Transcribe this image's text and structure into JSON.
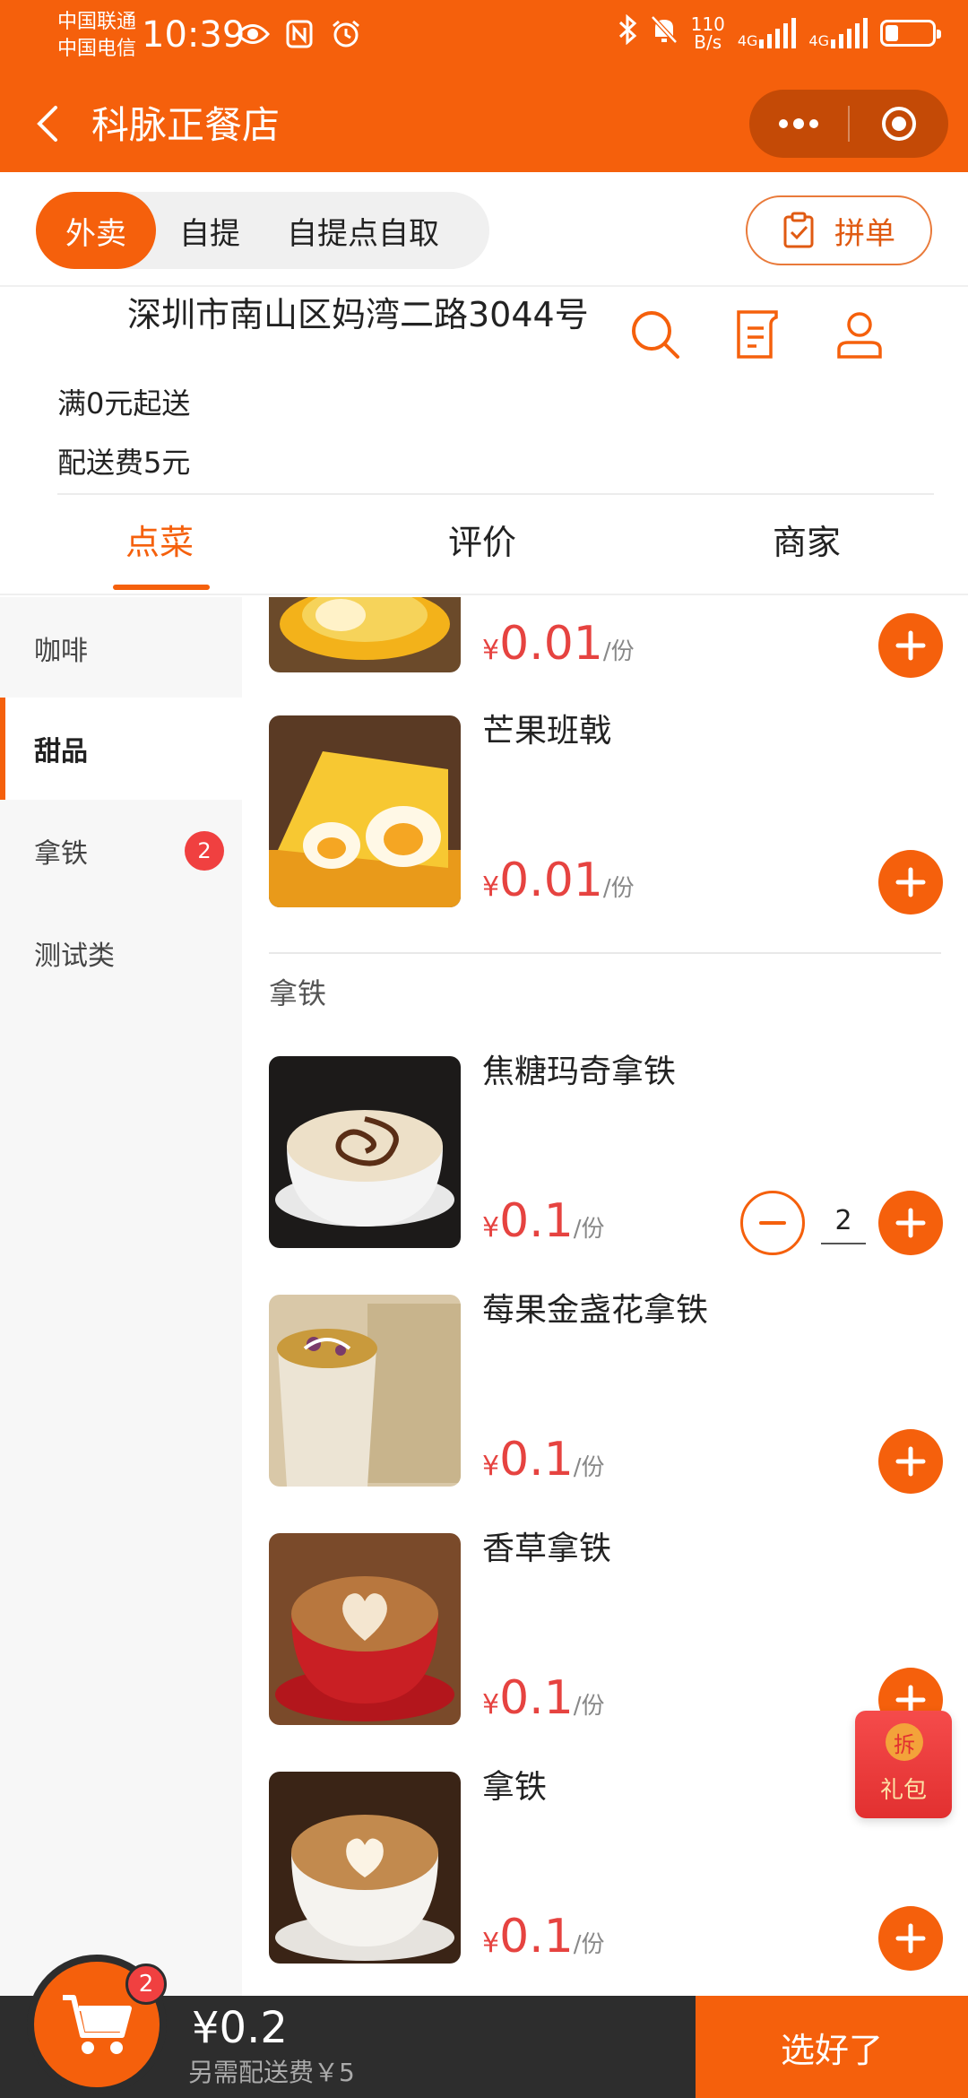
{
  "status_bar": {
    "carrier1": "中国联通",
    "carrier2": "中国电信",
    "time": "10:39",
    "speed_value": "110",
    "speed_unit": "B/s",
    "net1": "4G",
    "net2": "4G"
  },
  "titlebar": {
    "title": "科脉正餐店"
  },
  "modes": {
    "items": [
      "外卖",
      "自提",
      "自提点自取"
    ],
    "pin_label": "拼单"
  },
  "store": {
    "address": "深圳市南山区妈湾二路3044号",
    "min_order": "满0元起送",
    "delivery_fee": "配送费5元"
  },
  "tabs": [
    "点菜",
    "评价",
    "商家"
  ],
  "sidebar": {
    "items": [
      {
        "label": "咖啡"
      },
      {
        "label": "甜品"
      },
      {
        "label": "拿铁",
        "badge": "2"
      },
      {
        "label": "测试类"
      }
    ]
  },
  "products": {
    "partial": {
      "yen": "¥",
      "price": "0.01",
      "unit": "/份"
    },
    "mango": {
      "name": "芒果班戟",
      "yen": "¥",
      "price": "0.01",
      "unit": "/份"
    },
    "section_title": "拿铁",
    "caramel": {
      "name": "焦糖玛奇拿铁",
      "yen": "¥",
      "price": "0.1",
      "unit": "/份",
      "qty": "2"
    },
    "berry": {
      "name": "莓果金盏花拿铁",
      "yen": "¥",
      "price": "0.1",
      "unit": "/份"
    },
    "vanilla": {
      "name": "香草拿铁",
      "yen": "¥",
      "price": "0.1",
      "unit": "/份"
    },
    "latte": {
      "name": "拿铁",
      "yen": "¥",
      "price": "0.1",
      "unit": "/份"
    }
  },
  "gift": {
    "coin": "拆",
    "label": "礼包"
  },
  "cart": {
    "badge": "2",
    "total": "¥0.2",
    "fee_note": "另需配送费￥5",
    "done_label": "选好了"
  },
  "colors": {
    "accent": "#F5600C",
    "price": "#E64340",
    "badge": "#F04040"
  }
}
